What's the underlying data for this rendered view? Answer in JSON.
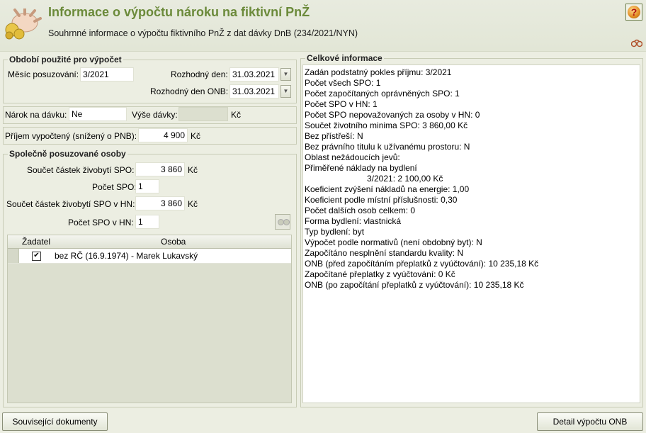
{
  "header": {
    "title": "Informace o výpočtu nároku na fiktivní PnŽ",
    "subtitle": "Souhrnné informace o výpočtu fiktivního PnŽ z dat dávky DnB (234/2021/NYN)",
    "help_label": "?"
  },
  "period": {
    "legend": "Období použité pro výpočet",
    "month_label": "Měsíc posuzování:",
    "month_value": "3/2021",
    "decisive_day_label": "Rozhodný den:",
    "decisive_day_value": "31.03.2021",
    "decisive_day_onb_label": "Rozhodný den ONB:",
    "decisive_day_onb_value": "31.03.2021"
  },
  "claim": {
    "claim_label": "Nárok na dávku:",
    "claim_value": "Ne",
    "amount_label": "Výše dávky:",
    "amount_value": "",
    "currency": "Kč"
  },
  "income": {
    "label": "Příjem vypočtený (snížený o PNB):",
    "value": "4 900",
    "currency": "Kč"
  },
  "persons": {
    "legend": "Společně posuzované osoby",
    "sum_label": "Součet částek živobytí SPO:",
    "sum_value": "3 860",
    "sum_currency": "Kč",
    "count_label": "Počet SPO:",
    "count_value": "1",
    "sum_hn_label": "Součet částek živobytí SPO v HN:",
    "sum_hn_value": "3 860",
    "sum_hn_currency": "Kč",
    "count_hn_label": "Počet SPO v HN:",
    "count_hn_value": "1",
    "columns": [
      "Žadatel",
      "Osoba"
    ],
    "rows": [
      {
        "applicant": true,
        "person": "bez RČ (16.9.1974) - Marek Lukavský"
      }
    ]
  },
  "overall": {
    "legend": "Celkové informace",
    "lines": [
      "Zadán podstatný pokles příjmu: 3/2021",
      "Počet všech SPO: 1",
      "Počet započítaných oprávněných SPO: 1",
      "Počet SPO v HN: 1",
      "Počet SPO nepovažovaných za osoby v HN: 0",
      "Součet životního minima SPO: 3 860,00 Kč",
      "Bez přístřeší: N",
      "Bez právního titulu k užívanému prostoru: N",
      "Oblast nežádoucích jevů:",
      "Přiměřené náklady na bydlení",
      "3/2021: 2 100,00 Kč",
      "Koeficient zvýšení nákladů na energie: 1,00",
      "Koeficient podle místní příslušnosti: 0,30",
      "Počet dalších osob celkem: 0",
      "Forma bydlení: vlastnická",
      "Typ bydlení: byt",
      "Výpočet podle normativů (není obdobný byt): N",
      "Započítáno nesplnění standardu kvality: N",
      "ONB (před započítáním přeplatků z vyúčtování): 10 235,18 Kč",
      "Započítané přeplatky z vyúčtování: 0 Kč",
      "ONB (po započítání přeplatků z vyúčtování): 10 235,18 Kč"
    ]
  },
  "footer": {
    "related_docs_label": "Související dokumenty",
    "detail_label": "Detail výpočtu ONB"
  }
}
